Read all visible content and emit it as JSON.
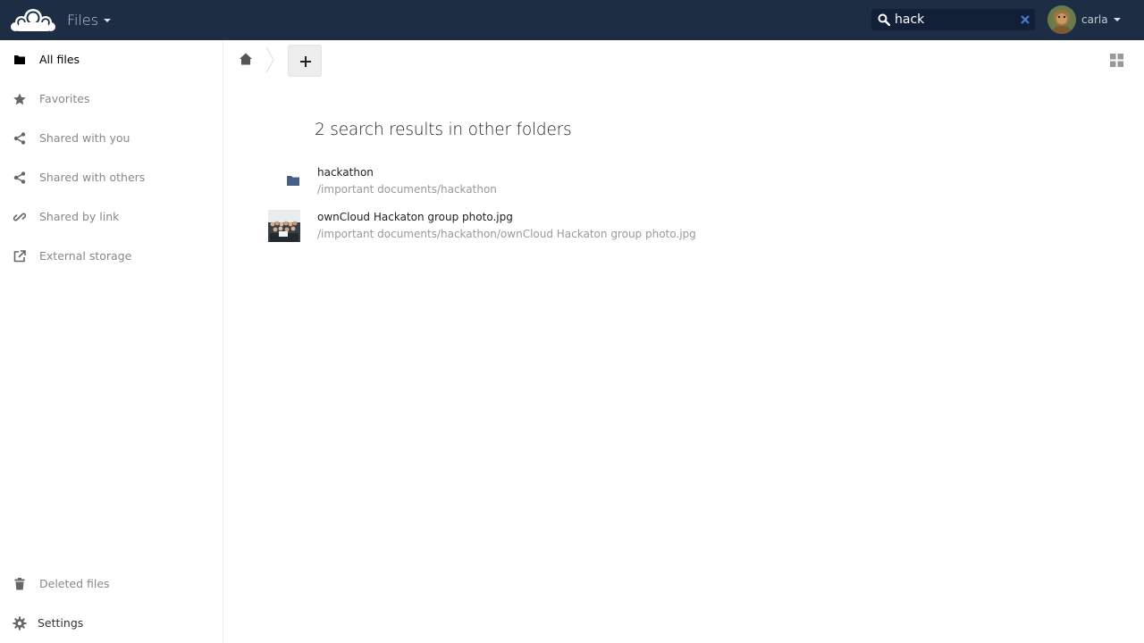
{
  "header": {
    "app_name": "Files",
    "search": {
      "value": "hack",
      "placeholder": ""
    },
    "user": {
      "name": "carla"
    },
    "colors": {
      "background": "#1d2d44",
      "search_bg": "#112036",
      "clear_icon": "#4a7fd6"
    }
  },
  "sidebar": {
    "items": [
      {
        "label": "All files",
        "icon": "folder-icon",
        "active": true
      },
      {
        "label": "Favorites",
        "icon": "star-icon"
      },
      {
        "label": "Shared with you",
        "icon": "share-icon"
      },
      {
        "label": "Shared with others",
        "icon": "share-icon"
      },
      {
        "label": "Shared by link",
        "icon": "link-icon"
      },
      {
        "label": "External storage",
        "icon": "external-link-icon"
      }
    ],
    "bottom": {
      "deleted": {
        "label": "Deleted files",
        "icon": "trash-icon"
      },
      "settings": {
        "label": "Settings",
        "icon": "gear-icon"
      }
    }
  },
  "main": {
    "results_title": "2 search results in other folders",
    "results": [
      {
        "name": "hackathon",
        "path": "/important documents/hackathon",
        "icon": "folder-icon",
        "icon_color": "#475f86"
      },
      {
        "name": "ownCloud Hackaton group photo.jpg",
        "path": "/important documents/hackathon/ownCloud Hackaton group photo.jpg",
        "icon": "photo-thumbnail"
      }
    ]
  }
}
